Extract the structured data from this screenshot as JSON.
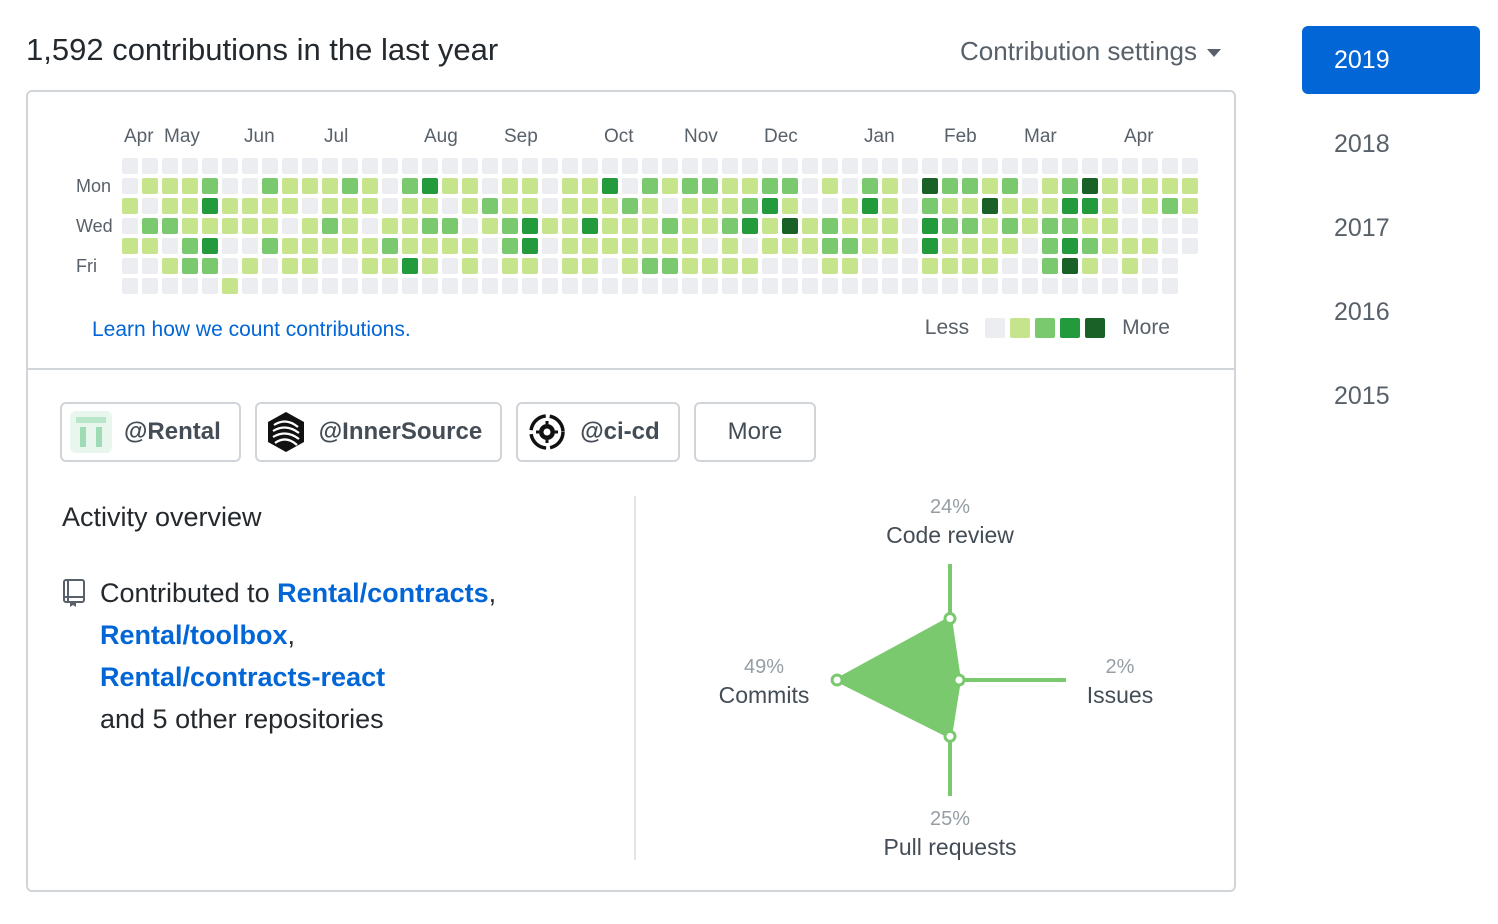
{
  "header": {
    "title": "1,592 contributions in the last year",
    "settings_label": "Contribution settings"
  },
  "calendar": {
    "months": [
      "Apr",
      "May",
      "Jun",
      "Jul",
      "Aug",
      "Sep",
      "Oct",
      "Nov",
      "Dec",
      "Jan",
      "Feb",
      "Mar",
      "Apr"
    ],
    "days": [
      "Mon",
      "Wed",
      "Fri"
    ],
    "learn_link": "Learn how we count contributions.",
    "legend_less": "Less",
    "legend_more": "More",
    "colors": [
      "#ebedf0",
      "#c6e48b",
      "#7bc96f",
      "#239a3b",
      "#196127"
    ],
    "weeks": [
      [
        0,
        0,
        1,
        0,
        1,
        0,
        0
      ],
      [
        0,
        1,
        0,
        2,
        1,
        0,
        0
      ],
      [
        0,
        1,
        1,
        2,
        0,
        1,
        0
      ],
      [
        0,
        1,
        1,
        1,
        2,
        2,
        0
      ],
      [
        0,
        2,
        3,
        1,
        3,
        2,
        0
      ],
      [
        0,
        0,
        1,
        1,
        0,
        0,
        1
      ],
      [
        0,
        0,
        1,
        1,
        0,
        1,
        0
      ],
      [
        0,
        2,
        1,
        1,
        2,
        0,
        0
      ],
      [
        0,
        1,
        1,
        0,
        1,
        1,
        0
      ],
      [
        0,
        1,
        0,
        1,
        1,
        1,
        0
      ],
      [
        0,
        1,
        1,
        2,
        1,
        0,
        0
      ],
      [
        0,
        2,
        1,
        1,
        1,
        0,
        0
      ],
      [
        0,
        1,
        1,
        0,
        1,
        1,
        0
      ],
      [
        0,
        0,
        0,
        1,
        2,
        1,
        0
      ],
      [
        0,
        2,
        1,
        1,
        1,
        3,
        0
      ],
      [
        0,
        3,
        1,
        2,
        1,
        1,
        0
      ],
      [
        0,
        1,
        0,
        2,
        1,
        0,
        0
      ],
      [
        0,
        1,
        1,
        0,
        1,
        1,
        0
      ],
      [
        0,
        0,
        2,
        1,
        0,
        0,
        0
      ],
      [
        0,
        1,
        1,
        2,
        2,
        1,
        0
      ],
      [
        0,
        1,
        1,
        3,
        3,
        1,
        0
      ],
      [
        0,
        0,
        0,
        1,
        0,
        0,
        0
      ],
      [
        0,
        1,
        1,
        1,
        1,
        1,
        0
      ],
      [
        0,
        1,
        1,
        3,
        1,
        1,
        0
      ],
      [
        0,
        3,
        1,
        1,
        1,
        0,
        0
      ],
      [
        0,
        0,
        2,
        1,
        1,
        1,
        0
      ],
      [
        0,
        2,
        1,
        1,
        1,
        2,
        0
      ],
      [
        0,
        1,
        0,
        2,
        1,
        2,
        0
      ],
      [
        0,
        2,
        1,
        1,
        1,
        1,
        0
      ],
      [
        0,
        2,
        1,
        1,
        0,
        1,
        0
      ],
      [
        0,
        1,
        1,
        2,
        1,
        1,
        0
      ],
      [
        0,
        1,
        2,
        3,
        0,
        1,
        0
      ],
      [
        0,
        2,
        3,
        1,
        1,
        0,
        0
      ],
      [
        0,
        2,
        1,
        4,
        1,
        0,
        0
      ],
      [
        0,
        0,
        0,
        1,
        1,
        0,
        0
      ],
      [
        0,
        1,
        0,
        2,
        2,
        1,
        0
      ],
      [
        0,
        0,
        1,
        1,
        2,
        1,
        0
      ],
      [
        0,
        2,
        3,
        1,
        1,
        0,
        0
      ],
      [
        0,
        1,
        1,
        1,
        1,
        0,
        0
      ],
      [
        0,
        0,
        0,
        0,
        0,
        0,
        0
      ],
      [
        0,
        4,
        2,
        3,
        3,
        1,
        0
      ],
      [
        0,
        2,
        1,
        2,
        1,
        1,
        0
      ],
      [
        0,
        2,
        1,
        2,
        1,
        1,
        0
      ],
      [
        0,
        1,
        4,
        1,
        1,
        1,
        0
      ],
      [
        0,
        2,
        1,
        2,
        1,
        0,
        0
      ],
      [
        0,
        0,
        1,
        1,
        0,
        0,
        0
      ],
      [
        0,
        1,
        1,
        2,
        2,
        2,
        0
      ],
      [
        0,
        2,
        3,
        2,
        3,
        4,
        0
      ],
      [
        0,
        4,
        3,
        1,
        2,
        1,
        0
      ],
      [
        0,
        1,
        1,
        1,
        1,
        0,
        0
      ],
      [
        0,
        1,
        0,
        0,
        1,
        1,
        0
      ],
      [
        0,
        1,
        1,
        0,
        1,
        0,
        0
      ],
      [
        0,
        1,
        2,
        0,
        0,
        0,
        0
      ],
      [
        0,
        1,
        1,
        0,
        0,
        0,
        0
      ]
    ]
  },
  "orgs": [
    {
      "name": "@Rental",
      "icon": "rental-logo-icon"
    },
    {
      "name": "@InnerSource",
      "icon": "innersource-logo-icon"
    },
    {
      "name": "@ci-cd",
      "icon": "ci-cd-logo-icon"
    }
  ],
  "orgs_more": "More",
  "activity": {
    "title": "Activity overview",
    "prefix": "Contributed to ",
    "repos": [
      "Rental/contracts",
      "Rental/toolbox",
      "Rental/contracts-react"
    ],
    "suffix": "and 5 other repositories",
    "icon": "repo-icon"
  },
  "radar": {
    "code_review": {
      "label": "Code review",
      "pct": "24%",
      "value": 24
    },
    "issues": {
      "label": "Issues",
      "pct": "2%",
      "value": 2
    },
    "pull_requests": {
      "label": "Pull requests",
      "pct": "25%",
      "value": 25
    },
    "commits": {
      "label": "Commits",
      "pct": "49%",
      "value": 49
    },
    "color": "#7bc96f"
  },
  "years": [
    "2019",
    "2018",
    "2017",
    "2016",
    "2015"
  ],
  "active_year": "2019"
}
